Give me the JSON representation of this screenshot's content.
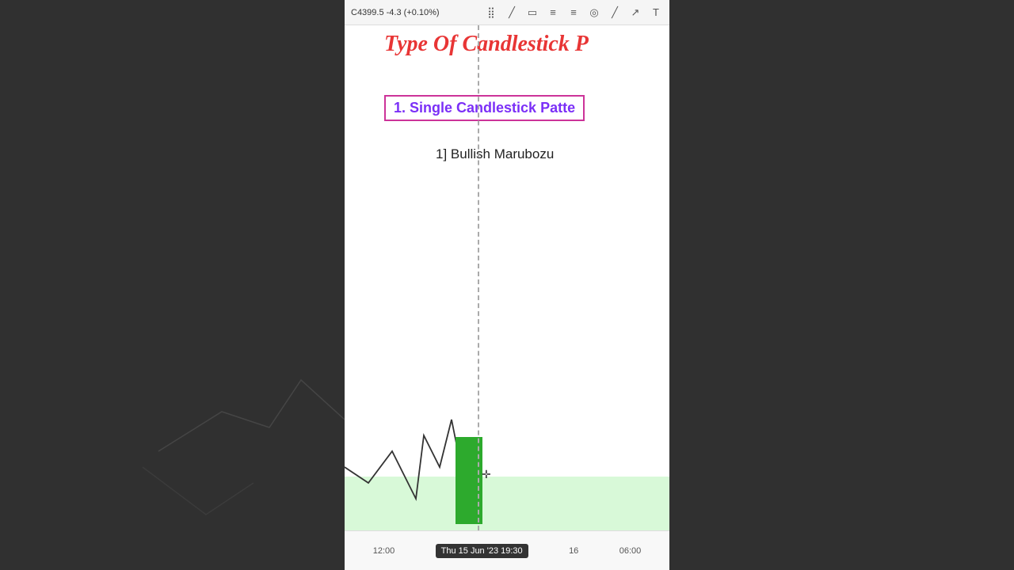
{
  "topbar": {
    "price": "C4399.5  -4.3 (+0.10%)",
    "icons": [
      "⣿",
      "╱",
      "▭",
      "≡",
      "≡",
      "◎",
      "╱",
      "↗",
      "T"
    ]
  },
  "title": {
    "main": "Type Of Candlestick P",
    "subtitle": "1. Single Candlestick Patte",
    "bullish": "1] Bullish Marubozu"
  },
  "time_axis": {
    "label_left": "12:00",
    "label_active": "Thu 15 Jun '23  19:30",
    "label_right_near": "16",
    "label_right_far": "06:00"
  },
  "colors": {
    "title_red": "#e83535",
    "subtitle_purple": "#7b2ff7",
    "subtitle_border": "#cc3399",
    "candle_green": "#2daa2d",
    "support_green": "rgba(144,238,144,0.35)"
  }
}
